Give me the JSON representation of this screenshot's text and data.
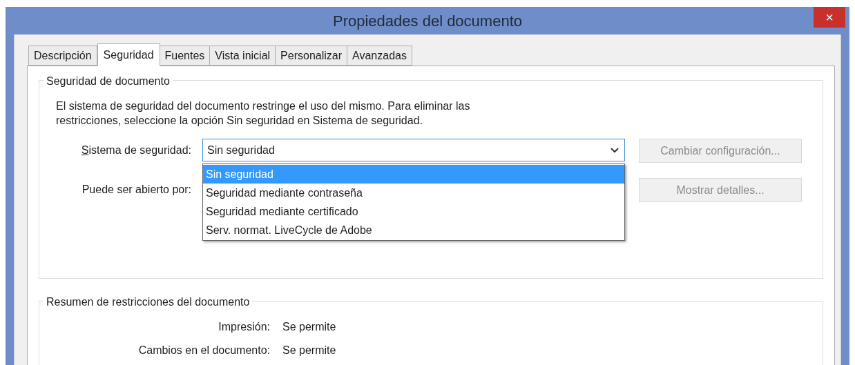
{
  "window": {
    "title": "Propiedades del documento",
    "close_label": "×"
  },
  "tabs": [
    {
      "label": "Descripción",
      "selected": false
    },
    {
      "label": "Seguridad",
      "selected": true
    },
    {
      "label": "Fuentes",
      "selected": false
    },
    {
      "label": "Vista inicial",
      "selected": false
    },
    {
      "label": "Personalizar",
      "selected": false
    },
    {
      "label": "Avanzadas",
      "selected": false
    }
  ],
  "security_group": {
    "title": "Seguridad de documento",
    "description": "El sistema de seguridad del documento restringe el uso del mismo. Para eliminar las restricciones, seleccione la opción Sin seguridad en Sistema de seguridad.",
    "system_label": "Sistema de seguridad:",
    "system_label_underlined_first": true,
    "system_value": "Sin seguridad",
    "expanded": true,
    "options": [
      {
        "label": "Sin seguridad",
        "selected": true
      },
      {
        "label": "Seguridad mediante contraseña",
        "selected": false
      },
      {
        "label": "Seguridad mediante certificado",
        "selected": false
      },
      {
        "label": "Serv. normat. LiveCycle de Adobe",
        "selected": false
      }
    ],
    "opened_by_label": "Puede ser abierto por:",
    "buttons": [
      {
        "label": "Cambiar configuración...",
        "disabled": true
      },
      {
        "label": "Mostrar detalles...",
        "disabled": true
      }
    ]
  },
  "summary_group": {
    "title": "Resumen de restricciones del documento",
    "rows": [
      {
        "label": "Impresión:",
        "value": "Se permite"
      },
      {
        "label": "Cambios en el documento:",
        "value": "Se permite"
      }
    ]
  }
}
